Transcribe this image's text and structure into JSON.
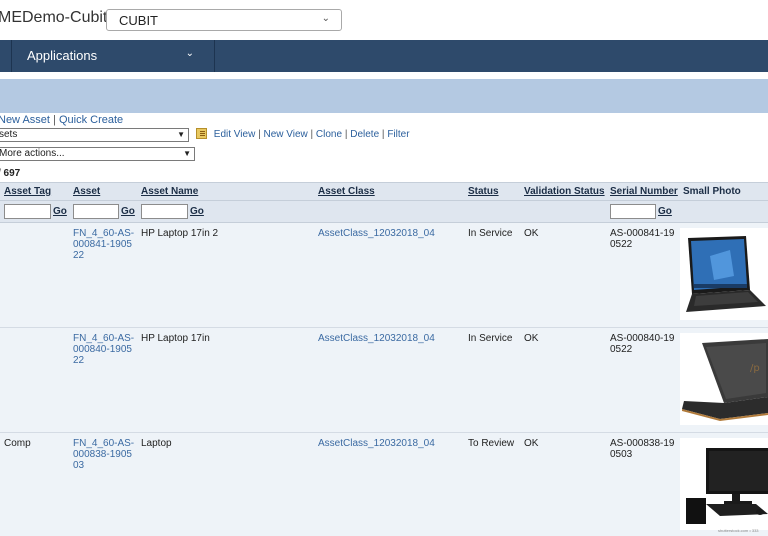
{
  "app": {
    "title": "MEDemo-Cubit",
    "company_selected": "CUBIT"
  },
  "nav": {
    "applications_label": "Applications"
  },
  "actions": {
    "new_asset": "New Asset",
    "quick_create": "Quick Create",
    "view_selected": "sets",
    "edit_view": "Edit View",
    "new_view": "New View",
    "clone": "Clone",
    "delete": "Delete",
    "filter": "Filter",
    "more_actions": "More actions..."
  },
  "list": {
    "count_label": "/ 697"
  },
  "columns": {
    "asset_tag": "Asset Tag",
    "asset": "Asset",
    "asset_name": "Asset Name",
    "asset_class": "Asset Class",
    "status": "Status",
    "validation_status": "Validation Status",
    "serial_number": "Serial Number",
    "small_photo": "Small Photo"
  },
  "filter": {
    "go_label": "Go"
  },
  "rows": [
    {
      "asset_tag": "",
      "asset": "FN_4_60-AS-000841-190522",
      "asset_name": "HP Laptop 17in 2",
      "asset_class": "AssetClass_12032018_04",
      "status": "In Service",
      "validation_status": "OK",
      "serial_number": "AS-000841-190522",
      "photo_icon": "laptop-front-photo"
    },
    {
      "asset_tag": "",
      "asset": "FN_4_60-AS-000840-190522",
      "asset_name": "HP Laptop 17in",
      "asset_class": "AssetClass_12032018_04",
      "status": "In Service",
      "validation_status": "OK",
      "serial_number": "AS-000840-190522",
      "photo_icon": "laptop-open-photo"
    },
    {
      "asset_tag": "Comp",
      "asset": "FN_4_60-AS-000838-190503",
      "asset_name": "Laptop",
      "asset_class": "AssetClass_12032018_04",
      "status": "To Review",
      "validation_status": "OK",
      "serial_number": "AS-000838-190503",
      "photo_icon": "desktop-computer-photo"
    }
  ],
  "photo_credit": "shutterstock.com • 333",
  "colors": {
    "nav_bg": "#2e4a6b",
    "header_band": "#b4c9e2",
    "link": "#2b5f9c",
    "grid_header": "#dfe6ef",
    "row_bg": "#eef3f8"
  }
}
